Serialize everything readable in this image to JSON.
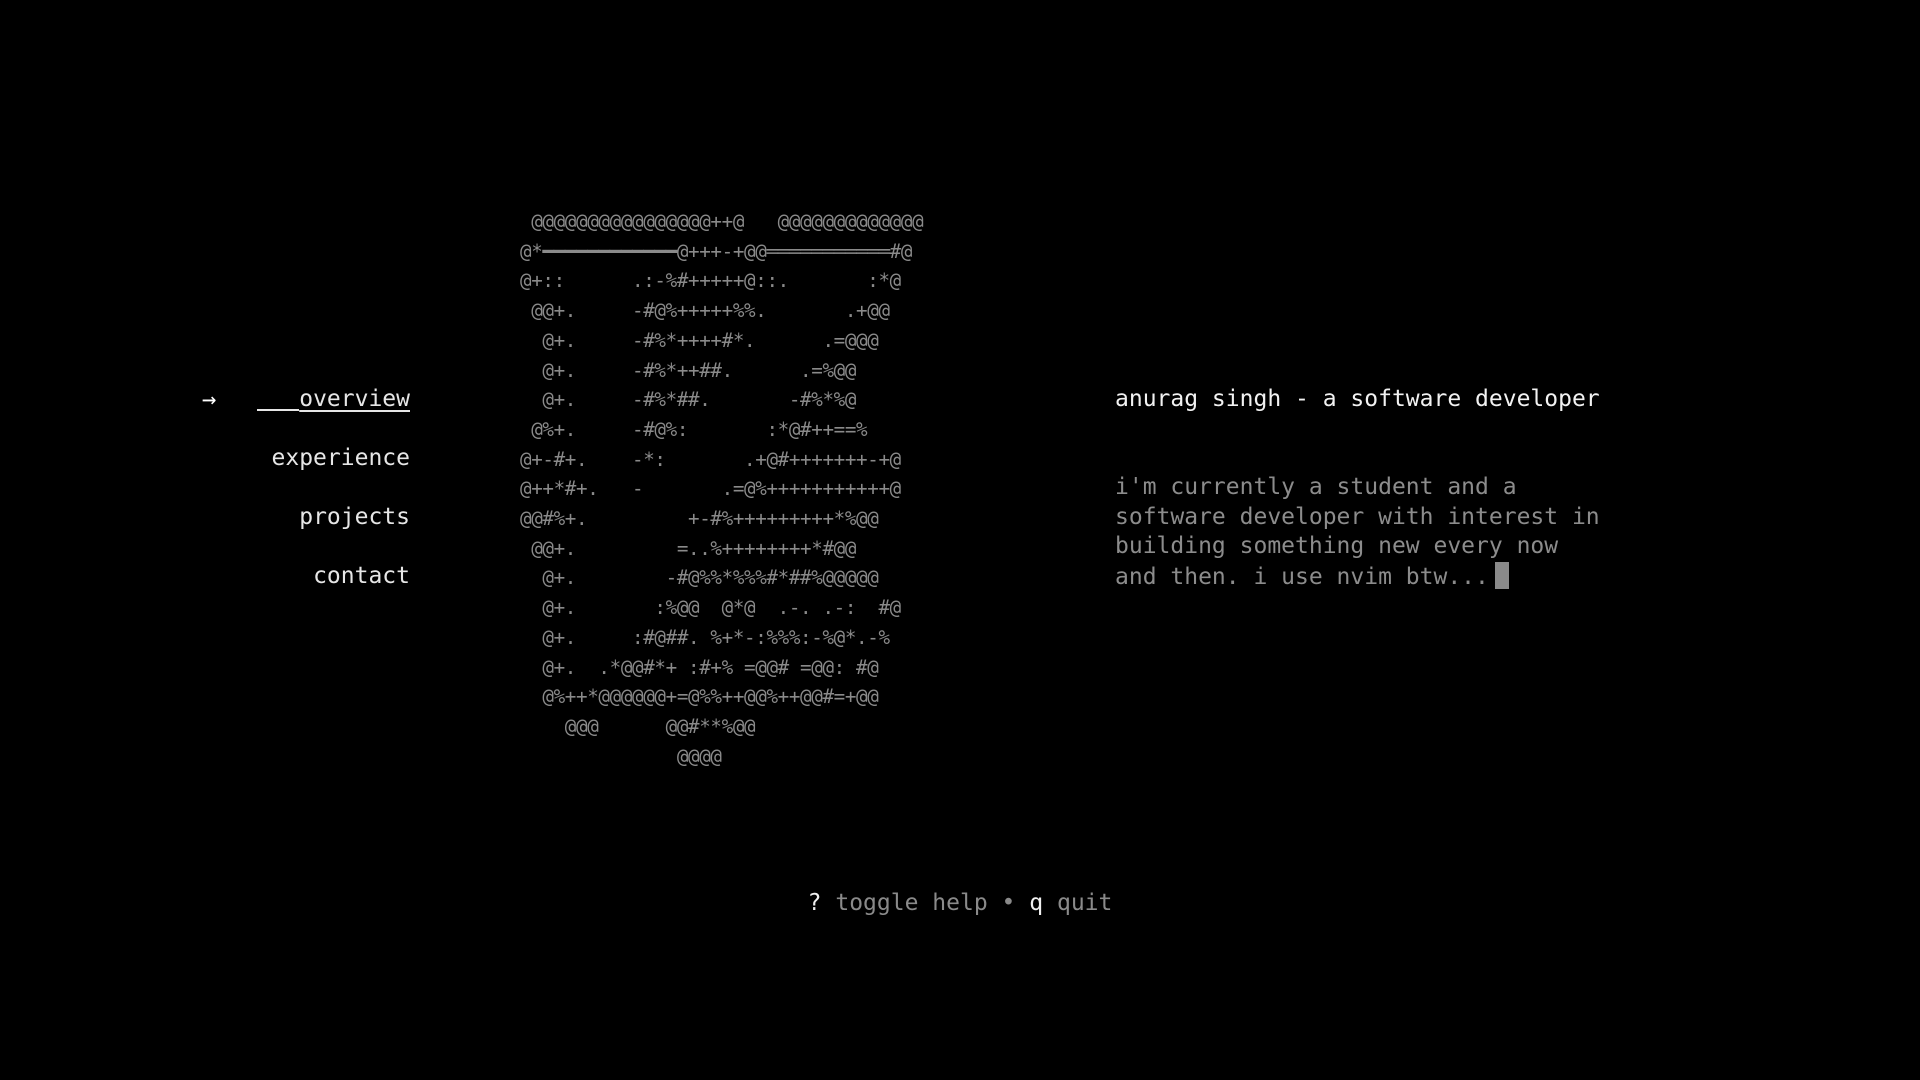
{
  "nav": {
    "arrow_icon": "→",
    "items": [
      {
        "label": "overview",
        "active": true
      },
      {
        "label": "experience",
        "active": false
      },
      {
        "label": "projects",
        "active": false
      },
      {
        "label": "contact",
        "active": false
      }
    ]
  },
  "ascii_art": [
    " @@@@@@@@@@@@@@@@++@   @@@@@@@@@@@@@",
    "@*━━━━━━━━━━━━@+++-+@@═══════════#@",
    "@+::      .:-%#+++++@::.       :*@",
    " @@+.     -#@%+++++%%.       .+@@",
    "  @+.     -#%*++++#*.      .=@@@",
    "  @+.     -#%*++##.      .=%@@",
    "  @+.     -#%*##.       -#%*%@",
    " @%+.     -#@%:       :*@#++==%",
    "@+-#+.    -*:       .+@#+++++++-+@",
    "@++*#+.   -       .=@%+++++++++++@",
    "@@#%+.         +-#%+++++++++*%@@",
    " @@+.         =..%++++++++*#@@",
    "  @+.        -#@%%*%%%#*##%@@@@@",
    "  @+.       :%@@  @*@  .-. .-:  #@",
    "  @+.     :#@##. %+*-:%%%:-%@*.-%",
    "  @+.  .*@@#*+ :#+% =@@# =@@: #@",
    "  @%++*@@@@@@+=@%%++@@%++@@#=+@@",
    "    @@@      @@#**%@@",
    "              @@@@"
  ],
  "content": {
    "headline": "anurag singh - a software developer",
    "body": "i'm currently a student and a\nsoftware developer with interest in\nbuilding something new every now\nand then. i use nvim btw..."
  },
  "help": {
    "key1": "?",
    "desc1": "toggle help",
    "separator": "•",
    "key2": "q",
    "desc2": "quit"
  },
  "colors": {
    "background": "#000000",
    "text_bright": "#f2f2f2",
    "text_dim": "#8a8a8a"
  }
}
